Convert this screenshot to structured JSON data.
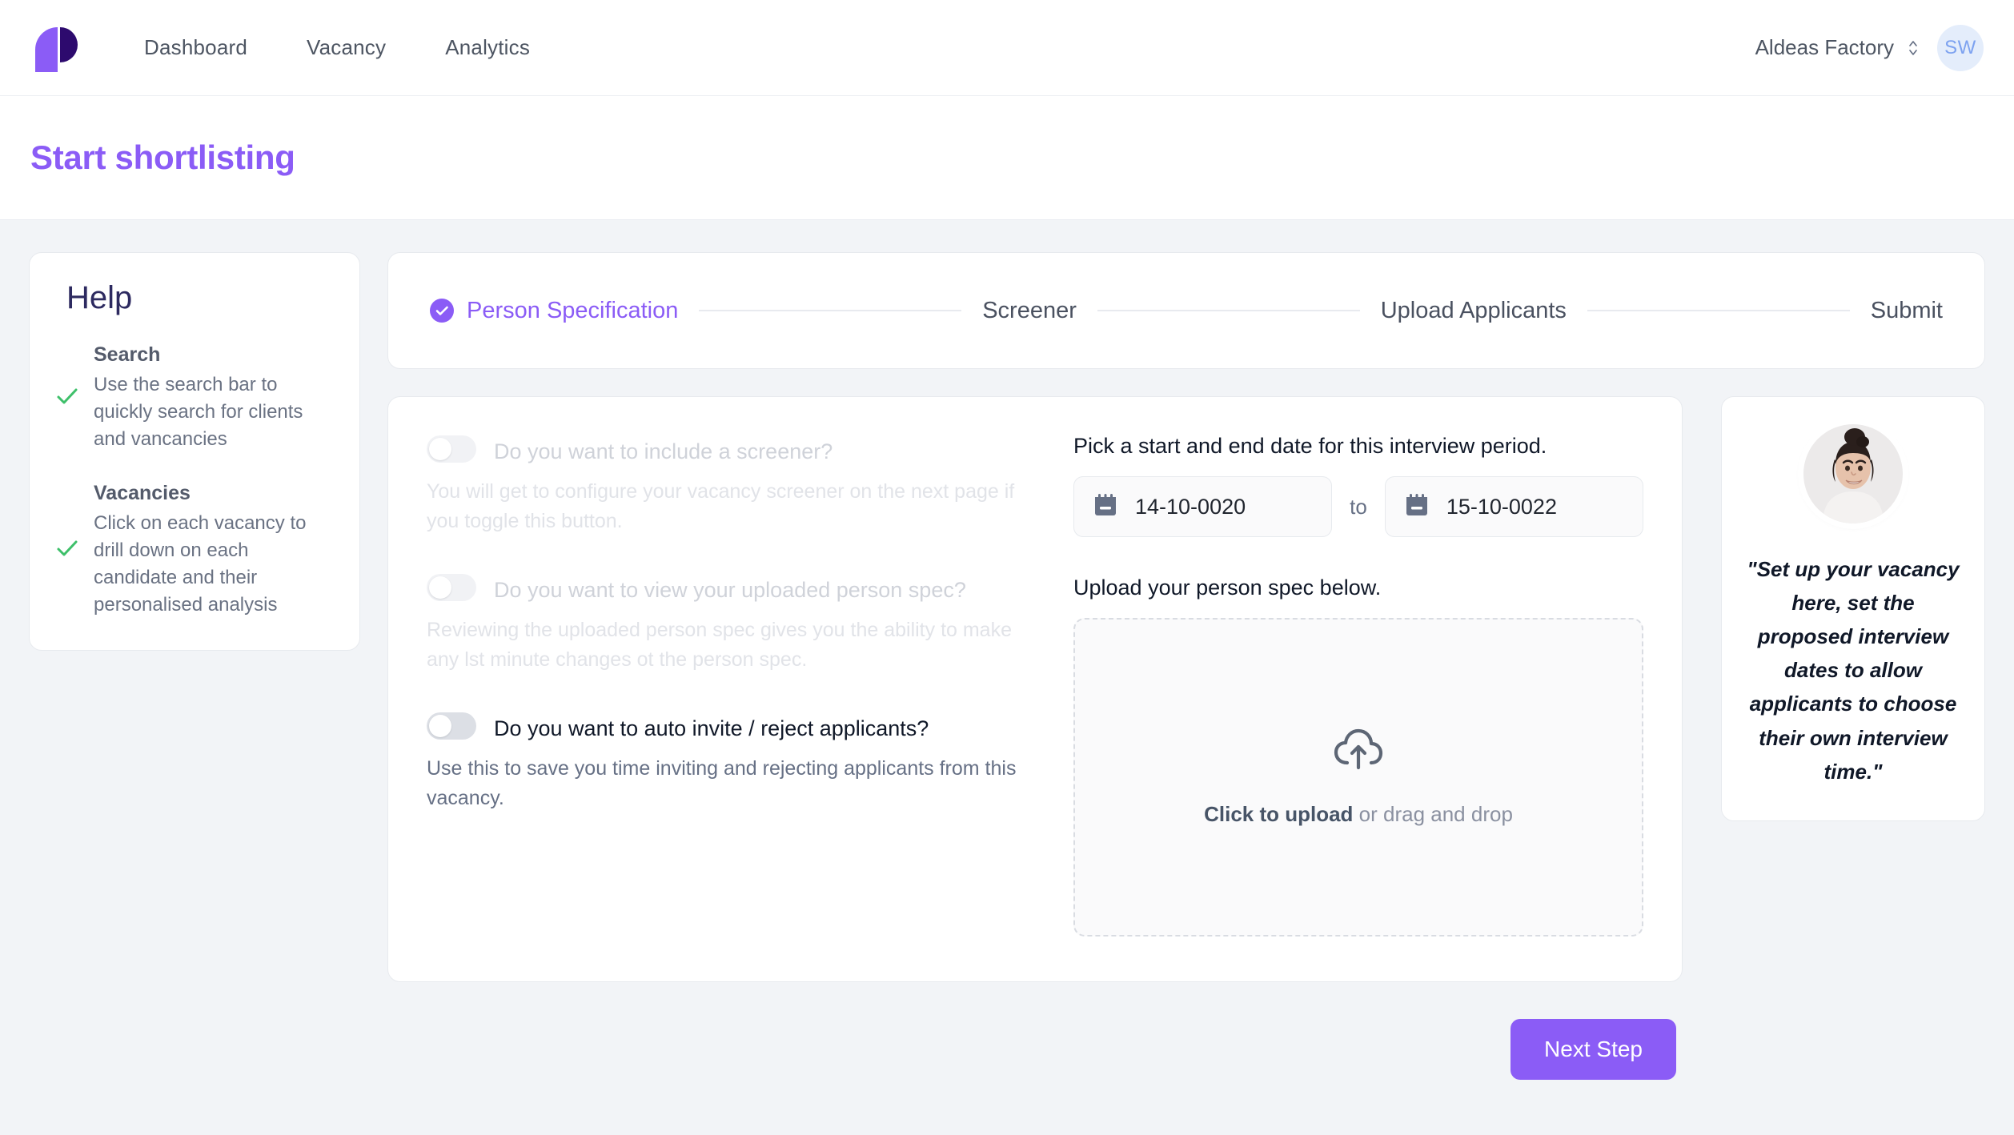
{
  "brand": {
    "logo_name": "prospela-logo",
    "accent_purple": "#8b5cf6",
    "logo_dark": "#2d0a6e"
  },
  "nav": {
    "links": [
      {
        "label": "Dashboard"
      },
      {
        "label": "Vacancy"
      },
      {
        "label": "Analytics"
      }
    ],
    "org_name": "Aldeas Factory",
    "avatar_initials": "SW"
  },
  "header": {
    "title": "Start shortlisting"
  },
  "help": {
    "title": "Help",
    "items": [
      {
        "title": "Search",
        "body": "Use the search bar to quickly search for clients and vancancies"
      },
      {
        "title": "Vacancies",
        "body": "Click on each vacancy to drill down on each candidate and their personalised analysis"
      }
    ]
  },
  "stepper": {
    "steps": [
      {
        "label": "Person  Specification",
        "state": "active"
      },
      {
        "label": "Screener",
        "state": "todo"
      },
      {
        "label": "Upload  Applicants",
        "state": "todo"
      },
      {
        "label": "Submit",
        "state": "todo"
      }
    ]
  },
  "form": {
    "toggles": [
      {
        "label": "Do you want to include a screener?",
        "desc": "You will get to configure your vacancy screener on the next page if you toggle this button.",
        "state": "off",
        "disabled": true
      },
      {
        "label": "Do you want to view your uploaded person spec?",
        "desc": "Reviewing the uploaded person spec gives you the ability to make any lst minute changes ot the person spec.",
        "state": "off",
        "disabled": true
      },
      {
        "label": "Do you want to auto invite / reject applicants?",
        "desc": "Use this to save you time inviting and rejecting applicants from this vacancy.",
        "state": "off",
        "disabled": false
      }
    ],
    "date_section_label": "Pick a start and end date for this interview period.",
    "start_date": "14-10-0020",
    "end_date": "15-10-0022",
    "date_separator": "to",
    "upload_section_label": "Upload your person spec below.",
    "dropzone_cta": "Click to upload",
    "dropzone_hint": " or drag and drop"
  },
  "tip": {
    "quote": "\"Set up your vacancy here, set the proposed interview dates to allow applicants to choose their own interview time.\""
  },
  "footer": {
    "next_label": "Next Step"
  }
}
